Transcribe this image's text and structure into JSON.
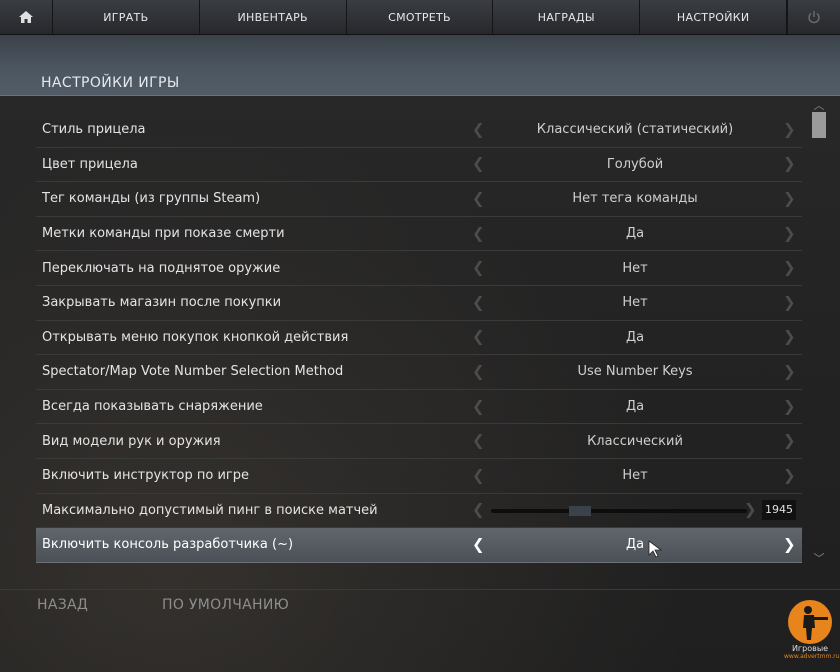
{
  "nav": {
    "home_icon": "home-icon",
    "items": [
      "ИГРАТЬ",
      "ИНВЕНТАРЬ",
      "СМОТРЕТЬ",
      "НАГРАДЫ",
      "НАСТРОЙКИ"
    ],
    "power_icon": "power-icon"
  },
  "page": {
    "title": "НАСТРОЙКИ ИГРЫ"
  },
  "settings": [
    {
      "label": "Стиль прицела",
      "value": "Классический (статический)"
    },
    {
      "label": "Цвет прицела",
      "value": "Голубой"
    },
    {
      "label": "Тег команды (из группы Steam)",
      "value": "Нет тега команды"
    },
    {
      "label": "Метки команды при показе смерти",
      "value": "Да"
    },
    {
      "label": "Переключать на поднятое оружие",
      "value": "Нет"
    },
    {
      "label": "Закрывать магазин после покупки",
      "value": "Нет"
    },
    {
      "label": "Открывать меню покупок кнопкой действия",
      "value": "Да"
    },
    {
      "label": "Spectator/Map Vote Number Selection Method",
      "value": "Use Number Keys"
    },
    {
      "label": "Всегда показывать снаряжение",
      "value": "Да"
    },
    {
      "label": "Вид модели рук и оружия",
      "value": "Классический"
    },
    {
      "label": "Включить инструктор по игре",
      "value": "Нет"
    },
    {
      "label": "Максимально допустимый пинг в поиске матчей",
      "slider_value": "1945"
    },
    {
      "label": "Включить консоль разработчика (~)",
      "value": "Да"
    }
  ],
  "arrows": {
    "left": "❮",
    "right": "❯"
  },
  "footer": {
    "back": "НАЗАД",
    "defaults": "ПО УМОЛЧАНИЮ"
  },
  "watermark": {
    "text": "Игровые",
    "sub": "www.advertmm.ru"
  },
  "colors": {
    "accent_orange": "#e8841c",
    "highlight_row": "#565c62",
    "banner": "#4c5661"
  }
}
